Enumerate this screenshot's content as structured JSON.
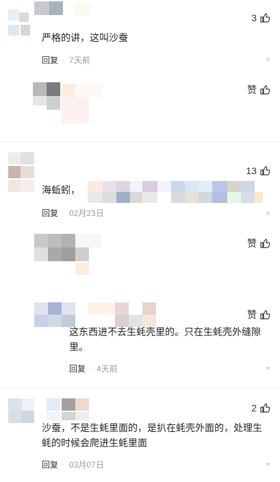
{
  "comments": [
    {
      "text": "严格的讲，这叫沙蚕",
      "reply": "回复",
      "time": "7天前",
      "likes": "3"
    },
    {
      "likes": "赞"
    },
    {
      "text": "海蚯蚓，",
      "reply": "回复",
      "time": "02月23日",
      "likes": "13"
    },
    {
      "likes": "赞"
    },
    {
      "text_line1": "这东西进不去生蚝壳里的。只在生蚝壳外缝隙",
      "text_line2": "里。",
      "reply": "回复",
      "time": "4天前",
      "likes": "赞"
    },
    {
      "text_line1": "沙蚕，不是生蚝里面的，是扒在蚝壳外面的，处理生",
      "text_line2": "蚝的时候会爬进生蚝里面",
      "reply": "回复",
      "time": "03月07日",
      "likes": "2"
    }
  ],
  "close_glyph": "×",
  "icon_like": "thumb-up-icon"
}
